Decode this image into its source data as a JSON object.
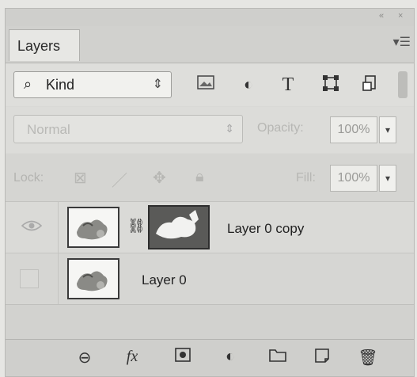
{
  "panel": {
    "tab_label": "Layers",
    "menu_icon": "panel-menu-icon",
    "window_controls": [
      "«",
      "×"
    ]
  },
  "filter": {
    "kind_label": "Kind",
    "icons": [
      "image-filter-icon",
      "adjustment-filter-icon",
      "type-filter-icon",
      "shape-filter-icon",
      "smart-object-filter-icon"
    ],
    "type_glyph": "T"
  },
  "blend": {
    "mode": "Normal",
    "opacity_label": "Opacity:",
    "opacity_value": "100%"
  },
  "lock": {
    "label": "Lock:",
    "fill_label": "Fill:",
    "fill_value": "100%"
  },
  "layers": [
    {
      "name": "Layer 0 copy",
      "visible": true,
      "has_mask": true
    },
    {
      "name": "Layer 0",
      "visible": false,
      "has_mask": false
    }
  ],
  "bottom_icons": [
    "link-layers-icon",
    "fx-icon",
    "add-mask-icon",
    "adjustment-layer-icon",
    "new-group-icon",
    "new-layer-icon",
    "delete-layer-icon"
  ],
  "bottom_fx_text": "fx"
}
